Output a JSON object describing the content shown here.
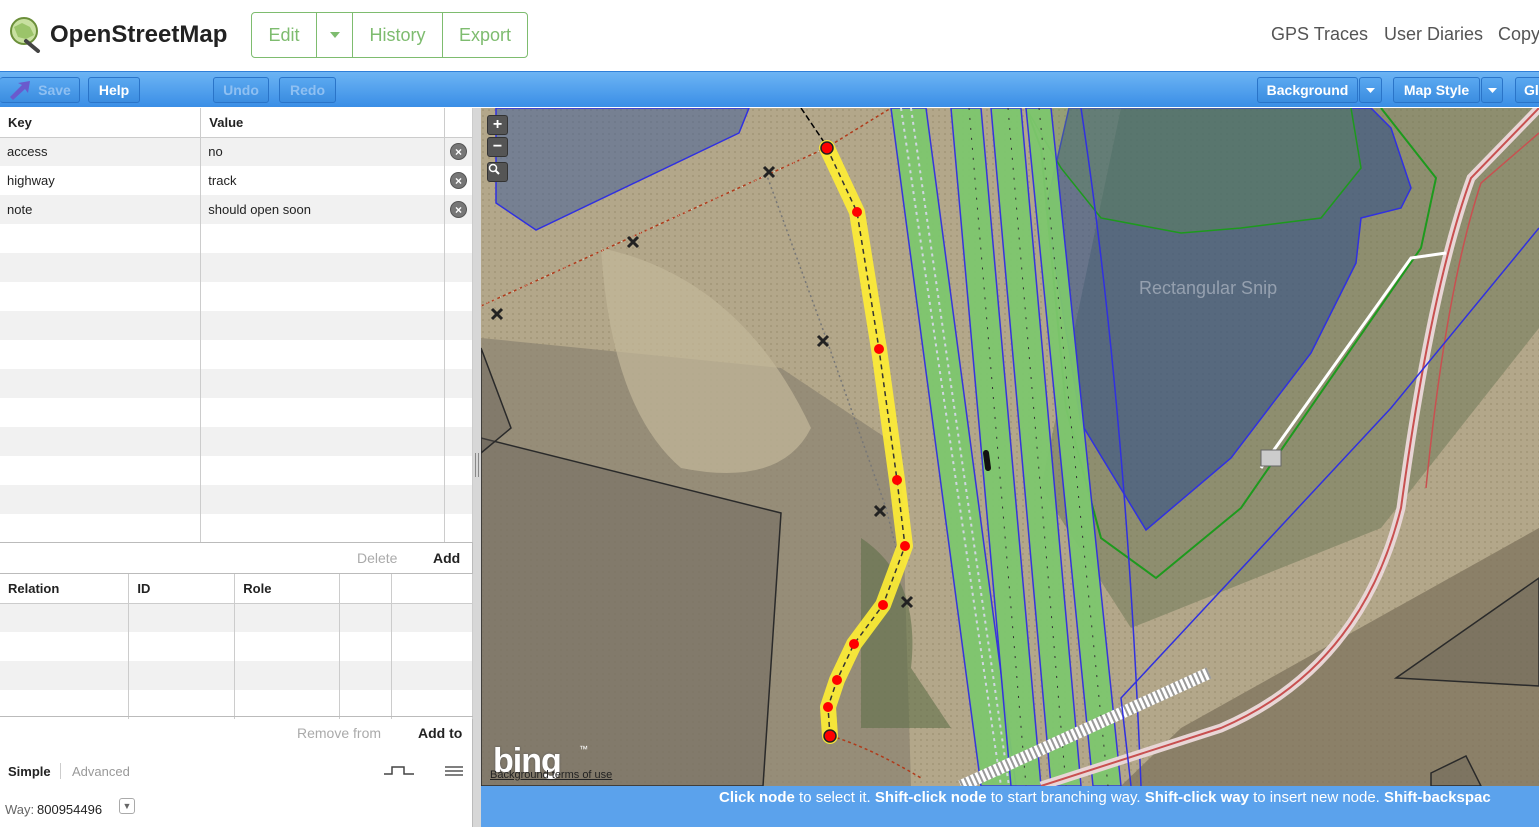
{
  "header": {
    "logo_text": "OpenStreetMap",
    "nav": {
      "edit": "Edit",
      "history": "History",
      "export": "Export"
    },
    "links": {
      "gps": "GPS Traces",
      "diaries": "User Diaries",
      "copyright": "Copy"
    },
    "accent": "#7ebc6f"
  },
  "toolbar": {
    "save": "Save",
    "help": "Help",
    "undo": "Undo",
    "redo": "Redo",
    "background": "Background",
    "map_style": "Map Style",
    "gps": "Gl"
  },
  "tags": {
    "headers": {
      "key": "Key",
      "value": "Value"
    },
    "rows": [
      {
        "key": "access",
        "value": "no"
      },
      {
        "key": "highway",
        "value": "track"
      },
      {
        "key": "note",
        "value": "should open soon"
      }
    ],
    "delete_label": "Delete",
    "add_label": "Add"
  },
  "relations": {
    "headers": {
      "relation": "Relation",
      "id": "ID",
      "role": "Role"
    },
    "remove_from_label": "Remove from",
    "add_to_label": "Add to"
  },
  "mode": {
    "simple": "Simple",
    "advanced": "Advanced"
  },
  "way": {
    "label": "Way:",
    "id": "800954496"
  },
  "map": {
    "bing_logo": "bing",
    "bing_tm": "™",
    "background_terms": "Background terms of use",
    "snip_ghost": "Rectangular Snip",
    "colors": {
      "selected_way": "#ffee33",
      "node": "#ff0000",
      "water": "#2a4a8a",
      "rail_fill": "#7ec76e"
    }
  },
  "status": {
    "parts": [
      {
        "bold": "Click node",
        "text": " to select it. "
      },
      {
        "bold": "Shift-click node",
        "text": " to start branching way. "
      },
      {
        "bold": "Shift-click way",
        "text": " to insert new node. "
      },
      {
        "bold": "Shift-backspac",
        "text": ""
      }
    ]
  }
}
